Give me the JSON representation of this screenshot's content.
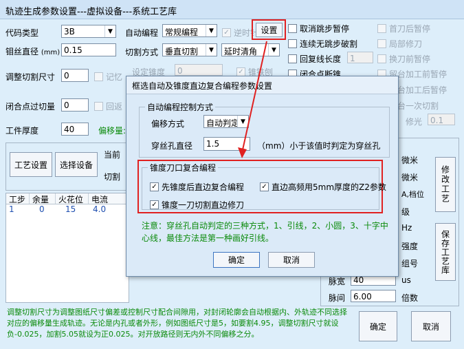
{
  "window": {
    "title": "轨迹生成参数设置---虚拟设备---系统工艺库"
  },
  "left": {
    "code_type_label": "代码类型",
    "code_type_value": "3B",
    "wire_dia_label": "钼丝直径",
    "wire_dia_unit": "(mm)",
    "wire_dia_value": "0.15",
    "adjust_label": "调整切割尺寸",
    "adjust_value": "0",
    "memo_label": "记忆",
    "closed_point_label": "闭合点过切量",
    "closed_point_value": "0",
    "return_label": "回返",
    "thickness_label": "工件厚度",
    "thickness_value": "40",
    "offset_label": "偏移量:",
    "process_btn": "工艺设置",
    "device_btn": "选择设备",
    "current_label": "当前",
    "cut_label": "切割",
    "table_headers": [
      "工步",
      "余量",
      "火花位",
      "电流"
    ],
    "table_rows": [
      [
        "1",
        "0",
        "15",
        "4.0"
      ]
    ]
  },
  "middle": {
    "auto_prog_label": "自动编程",
    "auto_prog_value": "常规编程",
    "reverse_cut_label": "逆时针",
    "settings_btn": "设置",
    "cut_mode_label": "切割方式",
    "cut_mode_value": "垂直切割",
    "delay_value": "延时清角",
    "taper_label": "设定锥度",
    "taper_value": "0",
    "taper_right_label": "锥铁刨"
  },
  "right": {
    "checks": [
      {
        "label": "取消跳步暂停",
        "checked": false,
        "enabled": true
      },
      {
        "label": "首刀后暂停",
        "checked": false,
        "enabled": false
      },
      {
        "label": "连续无跳步破割",
        "checked": false,
        "enabled": true
      },
      {
        "label": "局部修刀",
        "checked": false,
        "enabled": false
      },
      {
        "label": "回复线长度",
        "checked": false,
        "enabled": true
      },
      {
        "label": "换刀前暂停",
        "checked": false,
        "enabled": false
      },
      {
        "label": "闭合点断锥",
        "checked": false,
        "enabled": true
      },
      {
        "label": "留台加工前暂停",
        "checked": false,
        "enabled": false
      },
      {
        "label": "留台加工后暂停",
        "checked": false,
        "enabled": false
      },
      {
        "label": "留台一次切割",
        "checked": false,
        "enabled": false
      }
    ],
    "return_len_value": "1",
    "polish_label": "修光",
    "polish_value": "0.1",
    "units": [
      "微米",
      "微米",
      "A,档位",
      "级",
      "Hz",
      "强度",
      "组号",
      "us",
      "倍数"
    ],
    "pulse_width_label": "脉宽",
    "pulse_width_value": "40",
    "pulse_interval_label": "脉间",
    "pulse_interval_value": "6.00",
    "modify_btn": "修改工艺",
    "save_btn": "保存工艺库"
  },
  "bottom": {
    "note": "调整切割尺寸为调整图纸尺寸偏差或控制尺寸配合间隙用，对封闭轮廓会自动根据内、外轨迹不同选择对应的偏移量生成轨迹。无论是内孔或者外形，例如图纸尺寸是5，如要割4.95，调整切割尺寸就设负-0.025，加割5.05就设为正0.025。对开放路径则无内外不同偏移之分。",
    "ok_btn": "确定",
    "cancel_btn": "取消"
  },
  "dialog": {
    "title": "框选自动及锥度直边复合编程参数设置",
    "group1_title": "自动编程控制方式",
    "offset_mode_label": "偏移方式",
    "offset_mode_value": "自动判定",
    "hole_dia_label": "穿丝孔直径",
    "hole_dia_value": "1.5",
    "hole_dia_hint": "（mm）小于该值时判定为穿丝孔",
    "group2_title": "锥度刀口复合编程",
    "check1": "先锥度后直边复合编程",
    "check2": "直边高频用5mm厚度的Z2参数",
    "check3": "锥度一刀切割直边修刀",
    "note": "注意：穿丝孔自动判定的三种方式，1、引线，2、小圆，3、十字中心线，最佳方法是第一种画好引线。",
    "ok_btn": "确定",
    "cancel_btn": "取消"
  },
  "colors": {
    "highlight": "#e02020",
    "note_green": "#0a8a0a"
  }
}
